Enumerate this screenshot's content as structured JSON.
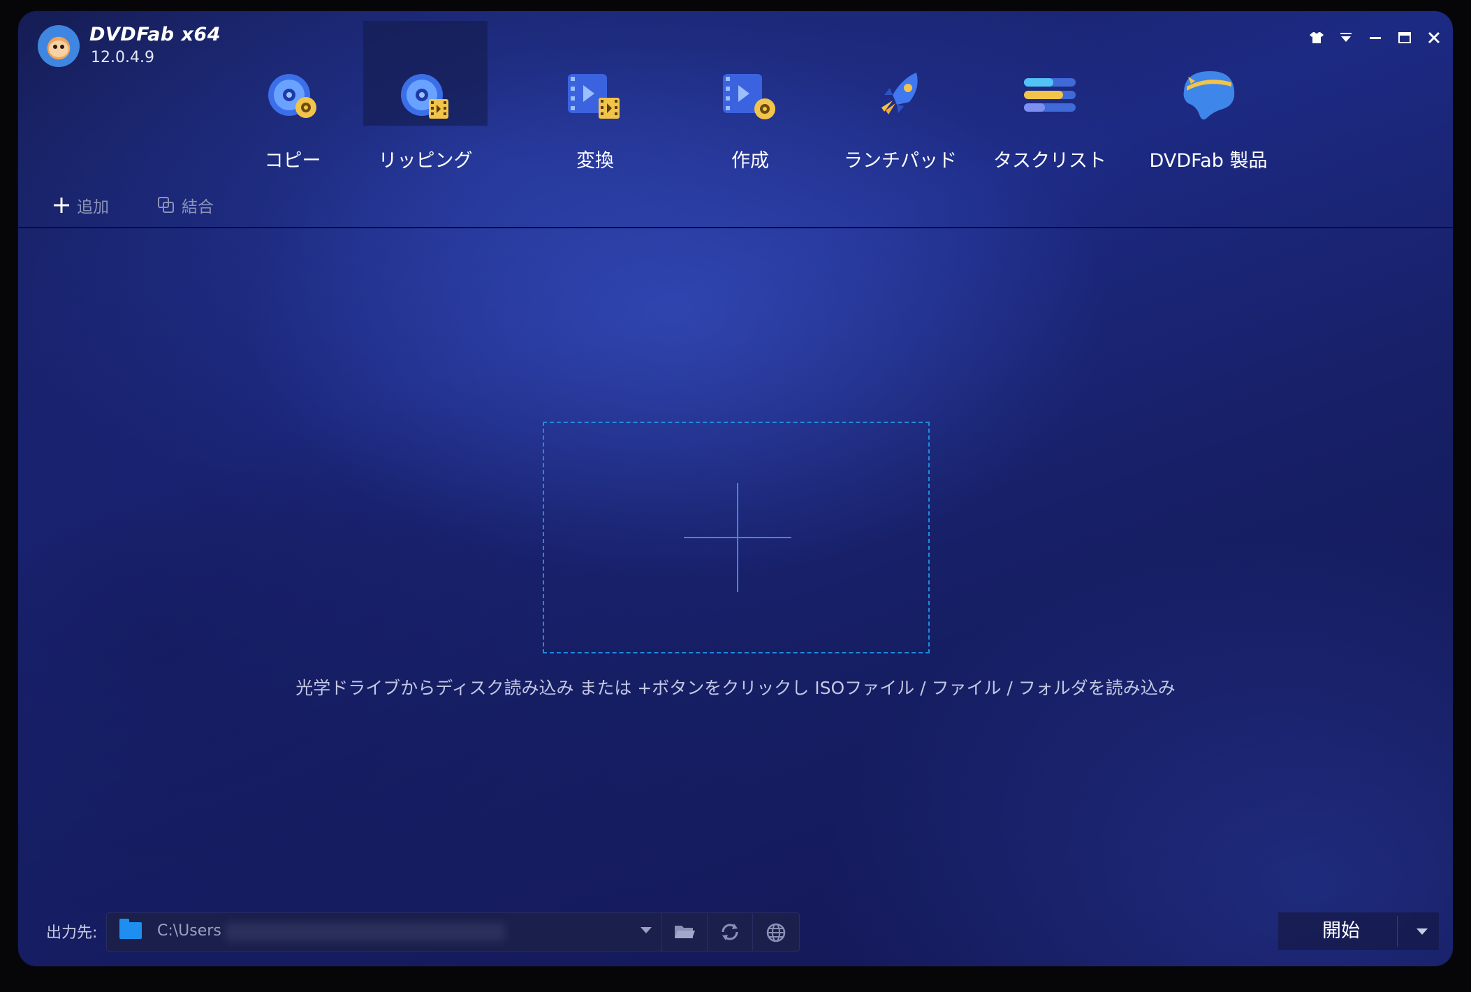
{
  "app": {
    "brand": "DVDFab x64",
    "version": "12.0.4.9"
  },
  "window_controls": [
    "skin-icon",
    "menu-icon",
    "minimize-icon",
    "maximize-icon",
    "close-icon"
  ],
  "nav": {
    "active": "ripping",
    "items": [
      {
        "id": "copy",
        "label": "コピー",
        "icon": "disc-copy-icon"
      },
      {
        "id": "ripping",
        "label": "リッピング",
        "icon": "disc-rip-icon"
      },
      {
        "id": "convert",
        "label": "変換",
        "icon": "video-convert-icon"
      },
      {
        "id": "create",
        "label": "作成",
        "icon": "video-create-icon"
      },
      {
        "id": "launchpad",
        "label": "ランチパッド",
        "icon": "rocket-icon"
      },
      {
        "id": "tasklist",
        "label": "タスクリスト",
        "icon": "task-list-icon"
      },
      {
        "id": "products",
        "label": "DVDFab 製品",
        "icon": "dvdfab-product-icon"
      }
    ]
  },
  "toolbar": {
    "add_label": "追加",
    "merge_label": "結合"
  },
  "dropzone": {
    "hint": "光学ドライブからディスク読み込み または +ボタンをクリックし ISOファイル / ファイル / フォルダを読み込み"
  },
  "output": {
    "label": "出力先:",
    "path": "C:\\Users"
  },
  "start": {
    "label": "開始"
  },
  "colors": {
    "accent": "#1c96ea",
    "folder": "#1e8ff0"
  }
}
